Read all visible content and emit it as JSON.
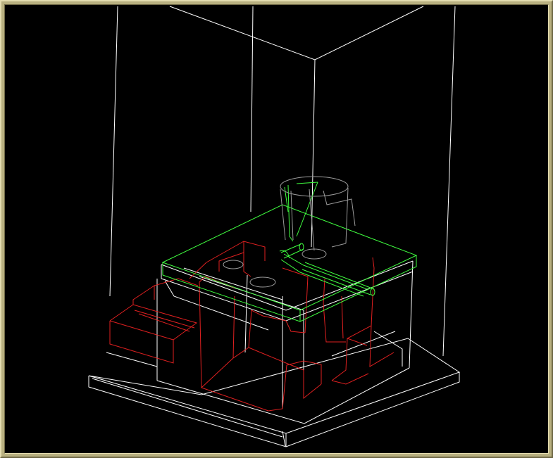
{
  "viewport": {
    "background": "#000000",
    "frame_color": "#b8b080",
    "layer_colors": {
      "enclosure": "#ffffff",
      "cavity": "#e02020",
      "feed_system": "#40ff40",
      "sprue_outline": "#9a9a9a"
    },
    "layers": [
      {
        "name": "enclosure",
        "icon": "wireframe-box-icon"
      },
      {
        "name": "cavity",
        "icon": "wireframe-part-icon"
      },
      {
        "name": "feed_system",
        "icon": "runner-icon"
      },
      {
        "name": "sprue_outline",
        "icon": "cylinder-icon"
      }
    ]
  }
}
